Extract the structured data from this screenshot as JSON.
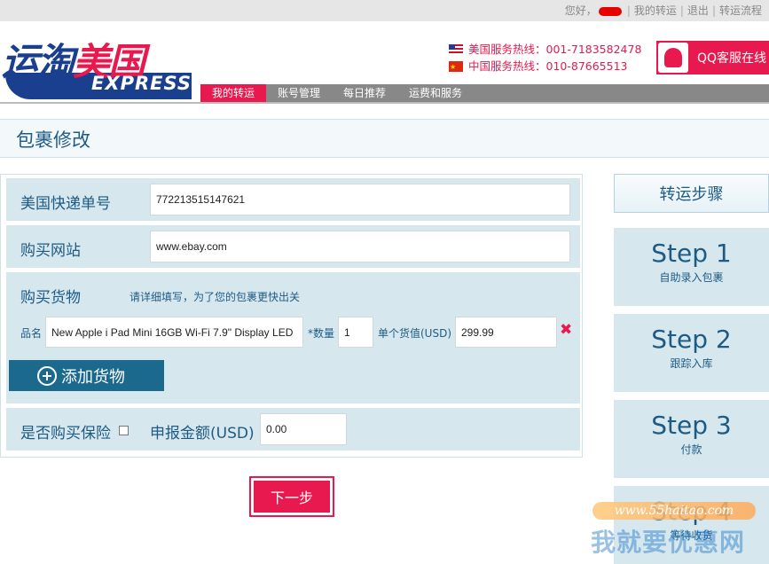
{
  "topbar": {
    "greeting": "您好，",
    "my_forwarding": "我的转运",
    "logout": "退出",
    "process": "转运流程",
    "separator": "|"
  },
  "logo": {
    "cn_part1": "运淘",
    "cn_part2": "美国",
    "en": "EXPRESS"
  },
  "hotline": {
    "us": "美国服务热线：001-7183582478",
    "cn": "中国服务热线：010-87665513"
  },
  "qq": {
    "label": "QQ客服在线"
  },
  "nav": {
    "items": [
      "我的转运",
      "账号管理",
      "每日推荐",
      "运费和服务"
    ]
  },
  "page": {
    "title": "包裹修改"
  },
  "form": {
    "tracking_label": "美国快递单号",
    "tracking_value": "772213515147621",
    "website_label": "购买网站",
    "website_value": "www.ebay.com",
    "goods_label": "购买货物",
    "goods_hint": "请详细填写，为了您的包裹更快出关",
    "item_name_label": "品名",
    "item_name_value": "New Apple i Pad Mini 16GB Wi-Fi 7.9\" Display LED",
    "qty_label": "*数量",
    "qty_value": "1",
    "unit_value_label": "单个货值(USD)",
    "unit_value": "299.99",
    "remove_symbol": "✖",
    "add_goods": "添加货物",
    "insurance_label": "是否购买保险",
    "declared_label": "申报金额(USD)",
    "declared_value": "0.00"
  },
  "next_button": "下一步",
  "steps": {
    "heading": "转运步骤",
    "items": [
      {
        "title": "Step 1",
        "desc": "自助录入包裹"
      },
      {
        "title": "Step 2",
        "desc": "跟踪入库"
      },
      {
        "title": "Step 3",
        "desc": "付款"
      },
      {
        "title": "Step 4",
        "desc": "等待收货"
      }
    ]
  },
  "watermark": {
    "url": "www.55haitao.com",
    "text": "我就要优惠网"
  },
  "colors": {
    "brand_pink": "#e8194e",
    "brand_blue": "#1b3f8f",
    "panel_bg": "#d7e7ee",
    "label_blue": "#1d5b85",
    "nav_gray": "#888888"
  }
}
